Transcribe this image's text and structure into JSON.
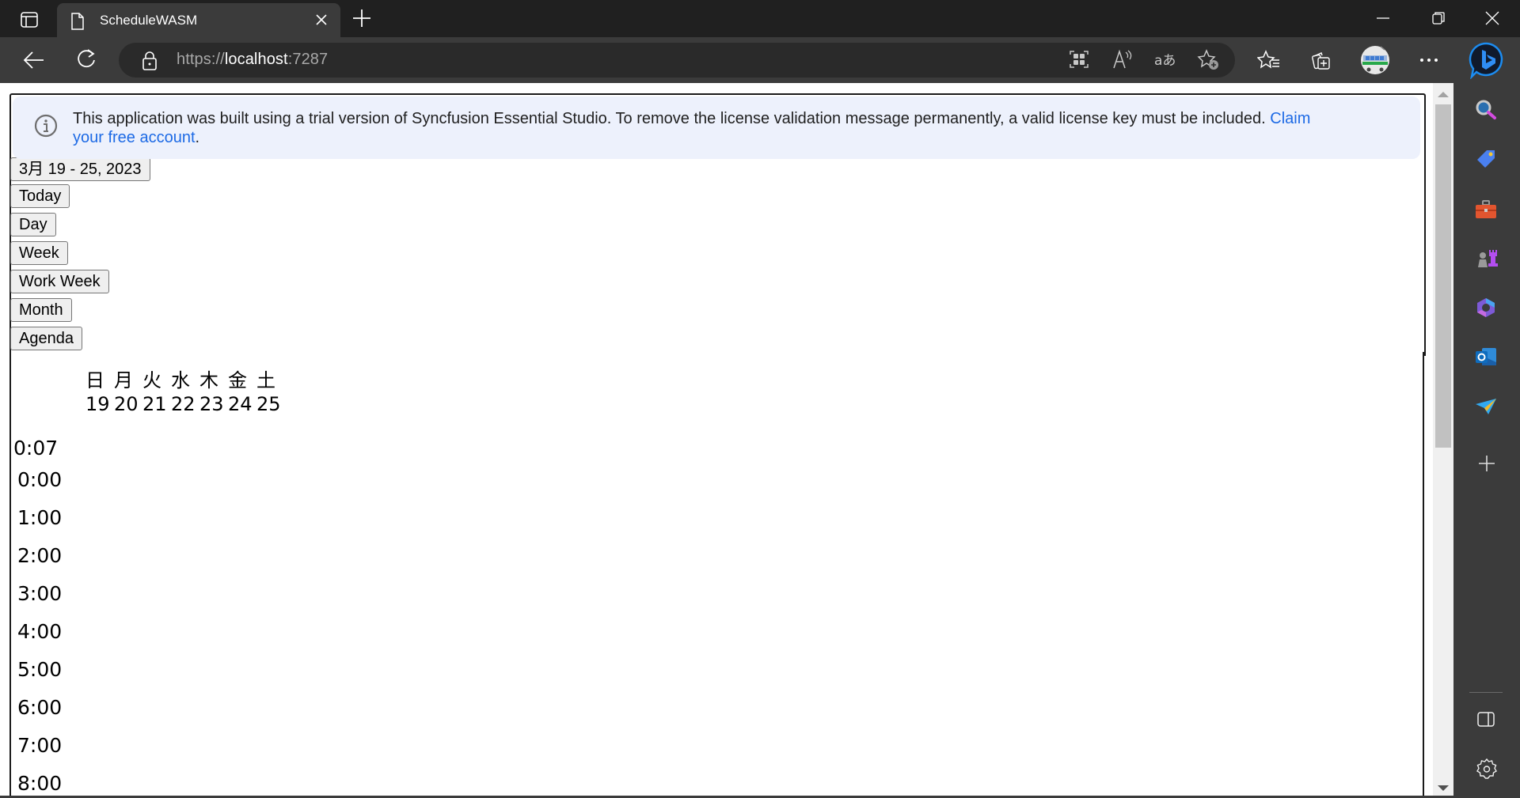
{
  "browser": {
    "tab_title": "ScheduleWASM",
    "url_scheme": "https://",
    "url_host": "localhost",
    "url_port": ":7287",
    "toolbar_icons": [
      "app-available-icon",
      "read-aloud-icon",
      "translate-icon",
      "add-favorite-icon",
      "favorites-icon",
      "collections-icon",
      "profile-avatar",
      "more-icon",
      "bing-chat-icon"
    ],
    "sidebar_icons": [
      "search-icon",
      "shopping-tag-icon",
      "tools-icon",
      "games-icon",
      "microsoft365-icon",
      "outlook-icon",
      "drop-icon",
      "add-icon",
      "split-screen-icon",
      "settings-icon"
    ]
  },
  "banner": {
    "message": "This application was built using a trial version of Syncfusion Essential Studio. To remove the license validation message permanently, a valid license key must be included. ",
    "link_text_1": "Claim",
    "link_text_2": "your free account",
    "suffix": "."
  },
  "scheduler": {
    "date_range_button": "3月 19 - 25, 2023",
    "view_buttons": [
      "Today",
      "Day",
      "Week",
      "Work Week",
      "Month",
      "Agenda"
    ],
    "day_names": [
      "日",
      "月",
      "火",
      "水",
      "木",
      "金",
      "土"
    ],
    "day_numbers": [
      "19",
      "20",
      "21",
      "22",
      "23",
      "24",
      "25"
    ],
    "current_time": "0:07",
    "time_slots": [
      "0:00",
      "1:00",
      "2:00",
      "3:00",
      "4:00",
      "5:00",
      "6:00",
      "7:00",
      "8:00"
    ]
  }
}
